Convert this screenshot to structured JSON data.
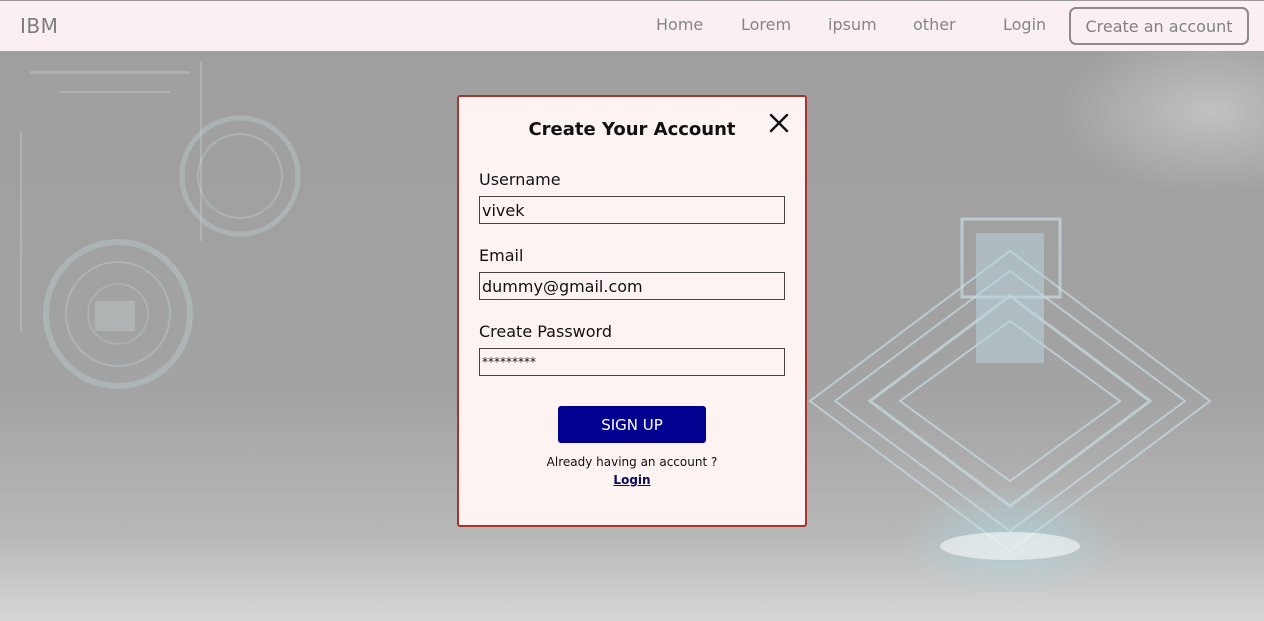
{
  "navbar": {
    "brand": "IBM",
    "links": [
      "Home",
      "Lorem",
      "ipsum",
      "other"
    ],
    "login_label": "Login",
    "create_account_label": "Create an account"
  },
  "modal": {
    "title": "Create Your Account",
    "close_icon": "close-icon",
    "fields": {
      "username": {
        "label": "Username",
        "value": "vivek"
      },
      "email": {
        "label": "Email",
        "value": "dummy@gmail.com"
      },
      "password": {
        "label": "Create Password",
        "value": "*********"
      }
    },
    "signup_label": "SIGN UP",
    "already_text": "Already having an account ?",
    "login_link": "Login"
  },
  "colors": {
    "navbar_bg": "#fbf0f1",
    "modal_bg": "#fdf3f3",
    "modal_border": "#a7342e",
    "signup_bg": "#02008f",
    "signup_text": "#ffffff"
  }
}
